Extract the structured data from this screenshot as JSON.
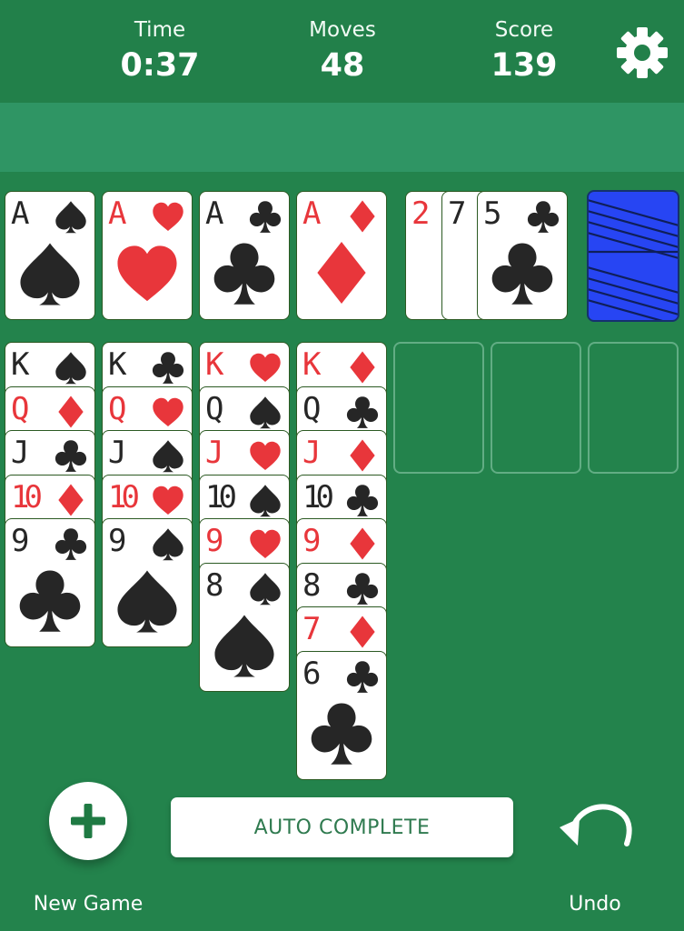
{
  "header": {
    "time_label": "Time",
    "time_value": "0:37",
    "moves_label": "Moves",
    "moves_value": "48",
    "score_label": "Score",
    "score_value": "139"
  },
  "colors": {
    "felt": "#23834c",
    "red": "#e8363b",
    "black": "#262626",
    "card_back": "#2745f3"
  },
  "foundations": [
    {
      "rank": "A",
      "suit": "spade"
    },
    {
      "rank": "A",
      "suit": "heart"
    },
    {
      "rank": "A",
      "suit": "club"
    },
    {
      "rank": "A",
      "suit": "diamond"
    }
  ],
  "waste": [
    {
      "rank": "2",
      "suit": "heart"
    },
    {
      "rank": "7",
      "suit": "club"
    },
    {
      "rank": "5",
      "suit": "club"
    }
  ],
  "stock": {
    "face_down": true,
    "icon": "card-back-icon"
  },
  "tableau": [
    [
      {
        "rank": "K",
        "suit": "spade"
      },
      {
        "rank": "Q",
        "suit": "diamond"
      },
      {
        "rank": "J",
        "suit": "club"
      },
      {
        "rank": "10",
        "suit": "diamond"
      },
      {
        "rank": "9",
        "suit": "club"
      }
    ],
    [
      {
        "rank": "K",
        "suit": "club"
      },
      {
        "rank": "Q",
        "suit": "heart"
      },
      {
        "rank": "J",
        "suit": "spade"
      },
      {
        "rank": "10",
        "suit": "heart"
      },
      {
        "rank": "9",
        "suit": "spade"
      }
    ],
    [
      {
        "rank": "K",
        "suit": "heart"
      },
      {
        "rank": "Q",
        "suit": "spade"
      },
      {
        "rank": "J",
        "suit": "heart"
      },
      {
        "rank": "10",
        "suit": "spade"
      },
      {
        "rank": "9",
        "suit": "heart"
      },
      {
        "rank": "8",
        "suit": "spade"
      }
    ],
    [
      {
        "rank": "K",
        "suit": "diamond"
      },
      {
        "rank": "Q",
        "suit": "club"
      },
      {
        "rank": "J",
        "suit": "diamond"
      },
      {
        "rank": "10",
        "suit": "club"
      },
      {
        "rank": "9",
        "suit": "diamond"
      },
      {
        "rank": "8",
        "suit": "club"
      },
      {
        "rank": "7",
        "suit": "diamond"
      },
      {
        "rank": "6",
        "suit": "club"
      }
    ],
    [],
    [],
    []
  ],
  "controls": {
    "new_game_label": "New Game",
    "auto_complete_label": "AUTO COMPLETE",
    "undo_label": "Undo",
    "settings_icon": "gear-icon"
  }
}
